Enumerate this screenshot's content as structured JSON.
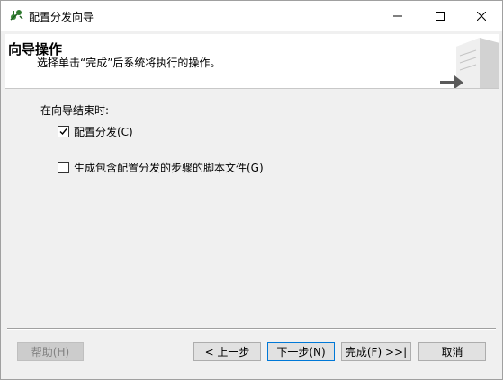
{
  "window": {
    "title": "配置分发向导"
  },
  "banner": {
    "title": "向导操作",
    "subtitle": "选择单击“完成”后系统将执行的操作。"
  },
  "content": {
    "section_label": "在向导结束时:",
    "options": [
      {
        "label": "配置分发(C)",
        "checked": true
      },
      {
        "label": "生成包含配置分发的步骤的脚本文件(G)",
        "checked": false
      }
    ]
  },
  "buttons": {
    "help": "帮助(H)",
    "back": "< 上一步",
    "next": "下一步(N)",
    "finish": "完成(F) >>|",
    "cancel": "取消"
  },
  "colors": {
    "accent": "#0078d7",
    "dialog_bg": "#f0f0f0",
    "banner_bg": "#ffffff"
  }
}
